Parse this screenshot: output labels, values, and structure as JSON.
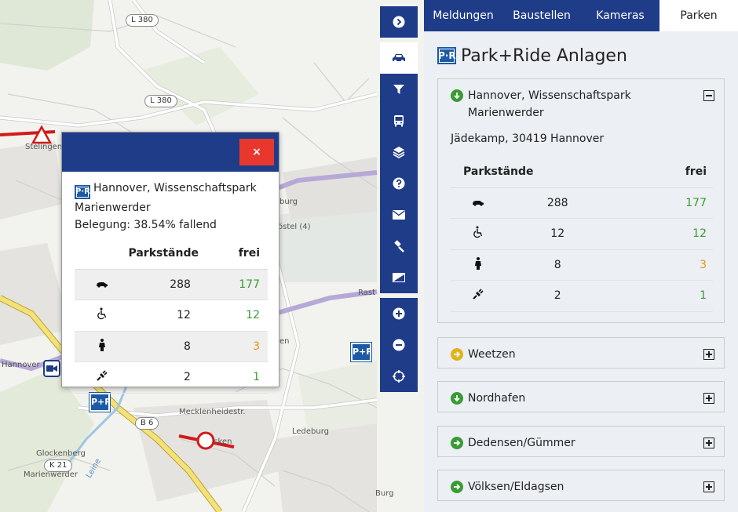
{
  "map": {
    "labels": {
      "l380_a": "L 380",
      "l380_b": "L 380",
      "stelingen": "Stelingen",
      "hannover": "Hannover",
      "b6": "B 6",
      "k21": "K 21",
      "glockenberg": "Glockenberg",
      "marienwerder": "Marienwerder",
      "mecklenheidestr": "Mecklenheidestr.",
      "ledeburg": "Ledeburg",
      "burg": "Burg",
      "leine": "Leine",
      "ostel": "östel (4)",
      "rast": "Rast",
      "burg2": "burg",
      "en": "en",
      "cken": "cken"
    },
    "marker_text": "P+R"
  },
  "toolbar": {
    "buttons": [
      {
        "name": "collapse-button",
        "icon": "chevron-right-circle-icon"
      },
      {
        "name": "car-layer-button",
        "icon": "car-icon",
        "active": true
      },
      {
        "name": "filter-button",
        "icon": "filter-icon"
      },
      {
        "name": "bus-layer-button",
        "icon": "bus-icon"
      },
      {
        "name": "layers-button",
        "icon": "layers-icon"
      },
      {
        "name": "help-button",
        "icon": "question-icon"
      },
      {
        "name": "mail-button",
        "icon": "envelope-icon"
      },
      {
        "name": "report-button",
        "icon": "gavel-icon"
      },
      {
        "name": "legend-button",
        "icon": "chart-icon"
      }
    ],
    "zoom": [
      {
        "name": "zoom-in-button",
        "icon": "plus-circle-icon"
      },
      {
        "name": "zoom-out-button",
        "icon": "minus-circle-icon"
      },
      {
        "name": "locate-button",
        "icon": "crosshair-icon"
      }
    ]
  },
  "popup": {
    "close_label": "×",
    "pr_badge": "P·R",
    "title": "Hannover, Wissenschaftspark",
    "title2": "Marienwerder",
    "occupancy": "Belegung: 38.54% fallend",
    "col_spaces": "Parkstände",
    "col_free": "frei",
    "rows": [
      {
        "icon": "car-icon",
        "spaces": "288",
        "free": "177",
        "color": "#3a9b35"
      },
      {
        "icon": "wheelchair-icon",
        "spaces": "12",
        "free": "12",
        "color": "#3a9b35"
      },
      {
        "icon": "woman-icon",
        "spaces": "8",
        "free": "3",
        "color": "#e8950c"
      },
      {
        "icon": "ev-plug-icon",
        "spaces": "2",
        "free": "1",
        "color": "#3a9b35"
      }
    ]
  },
  "panel": {
    "tabs": [
      {
        "label": "Meldungen"
      },
      {
        "label": "Baustellen"
      },
      {
        "label": "Kameras"
      },
      {
        "label": "Parken",
        "active": true
      }
    ],
    "heading": "Park+Ride Anlagen",
    "pr_badge": "P·R",
    "facilities": [
      {
        "name": "Hannover, Wissenschaftspark",
        "name2": "Marienwerder",
        "status_icon": "arrow-down-icon",
        "status_color": "#3a9b35",
        "expanded": true,
        "address": "Jädekamp, 30419 Hannover",
        "col_spaces": "Parkstände",
        "col_free": "frei",
        "rows": [
          {
            "icon": "car-icon",
            "spaces": "288",
            "free": "177",
            "color": "#3a9b35"
          },
          {
            "icon": "wheelchair-icon",
            "spaces": "12",
            "free": "12",
            "color": "#3a9b35"
          },
          {
            "icon": "woman-icon",
            "spaces": "8",
            "free": "3",
            "color": "#e8950c"
          },
          {
            "icon": "ev-plug-icon",
            "spaces": "2",
            "free": "1",
            "color": "#3a9b35"
          }
        ]
      },
      {
        "name": "Weetzen",
        "status_icon": "arrow-right-icon",
        "status_color": "#e0b31a"
      },
      {
        "name": "Nordhafen",
        "status_icon": "arrow-down-icon",
        "status_color": "#3a9b35"
      },
      {
        "name": "Dedensen/Gümmer",
        "status_icon": "arrow-right-icon",
        "status_color": "#3a9b35"
      },
      {
        "name": "Völksen/Eldagsen",
        "status_icon": "arrow-right-icon",
        "status_color": "#3a9b35"
      }
    ]
  }
}
